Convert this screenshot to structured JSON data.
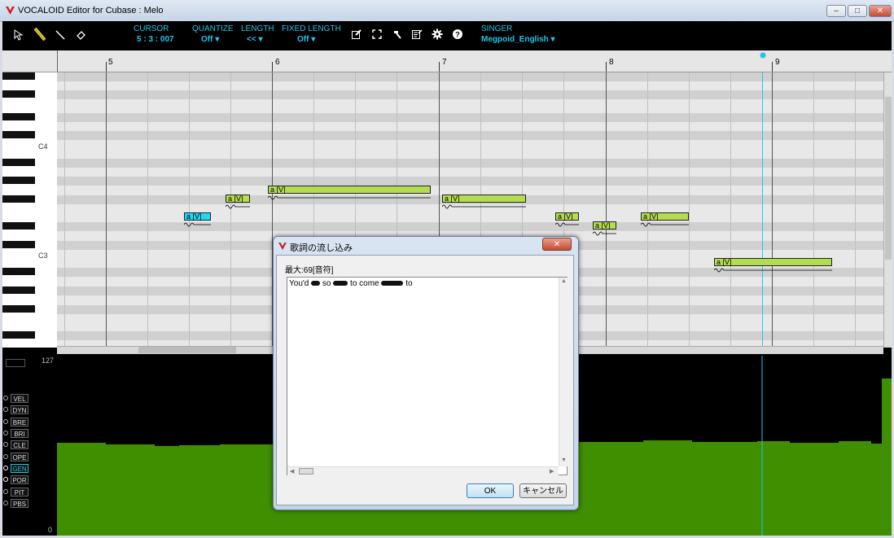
{
  "window": {
    "title": "VOCALOID Editor for Cubase : Melo",
    "minimize": "‒",
    "maximize": "□",
    "close": "✕"
  },
  "toolbar": {
    "cursor_label": "CURSOR",
    "cursor_value": "5 : 3 : 007",
    "quantize_label": "QUANTIZE",
    "quantize_value": "Off ▾",
    "length_label": "LENGTH",
    "length_value": "<< ▾",
    "fixed_length_label": "FIXED LENGTH",
    "fixed_length_value": "Off ▾",
    "singer_label": "SINGER",
    "singer_value": "Megpoid_English ▾"
  },
  "ruler": {
    "measures": [
      "5",
      "6",
      "7",
      "8",
      "9"
    ]
  },
  "keyboard": {
    "labels": [
      "C4",
      "C3"
    ]
  },
  "notes": [
    {
      "lyric": "a [V]"
    },
    {
      "lyric": "a [V]"
    },
    {
      "lyric": "a [V]"
    },
    {
      "lyric": "a [V]"
    },
    {
      "lyric": "a [V]"
    },
    {
      "lyric": "a [V]"
    },
    {
      "lyric": "a [V]"
    },
    {
      "lyric": "a [V]"
    }
  ],
  "control_track": {
    "max": "127",
    "min": "0",
    "params": [
      "VEL",
      "DYN",
      "BRE",
      "BRI",
      "CLE",
      "OPE",
      "GEN",
      "POR",
      "PIT",
      "PBS"
    ],
    "active_param": "GEN"
  },
  "dialog": {
    "title": "歌詞の流し込み",
    "close": "✕",
    "max_label": "最大:69[音符]",
    "lyrics_text": [
      "You'd",
      "so",
      "to come",
      "to"
    ],
    "ok": "OK",
    "cancel": "キャンセル"
  },
  "colors": {
    "accent": "#22c4e6",
    "note": "#b3dd4c",
    "note_selected": "#22d8ef",
    "control_fill": "#3f8f00"
  }
}
